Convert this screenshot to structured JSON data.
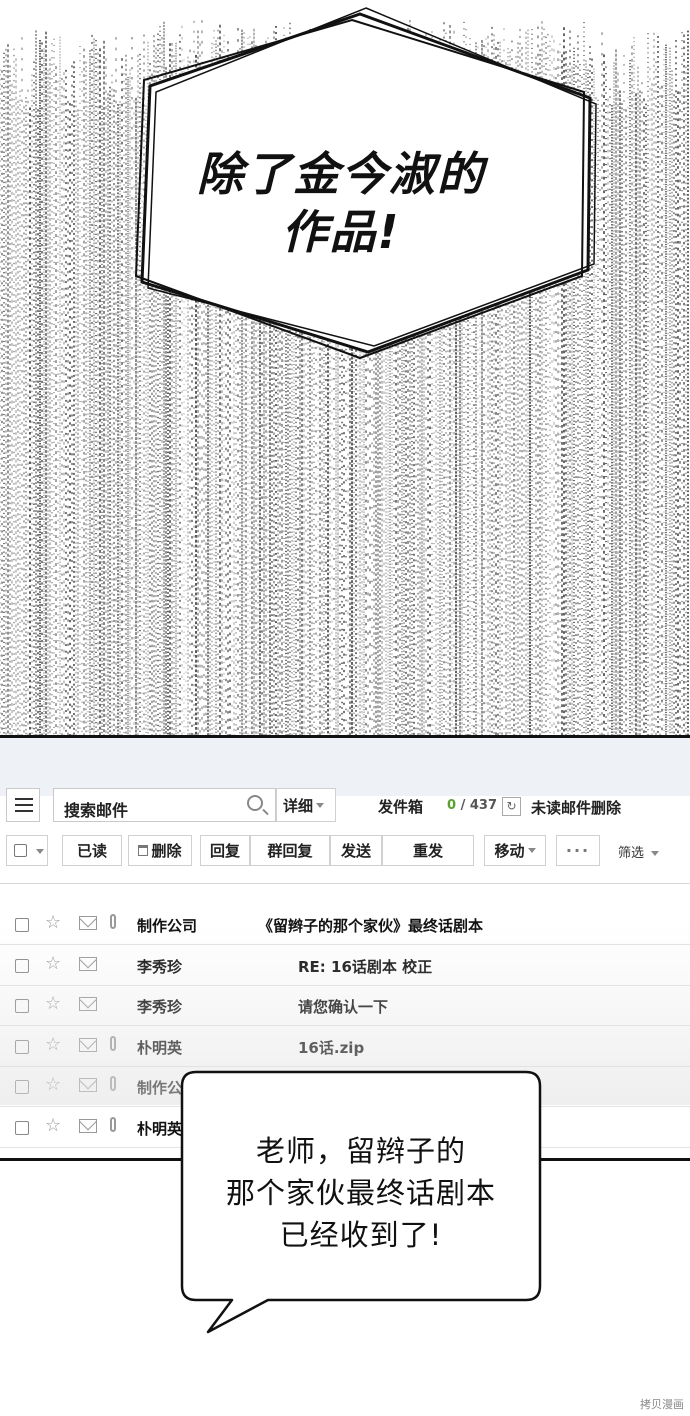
{
  "top_panel": {
    "shout_line_1": "除了金今淑的",
    "shout_line_2": "作品!"
  },
  "mail": {
    "search_placeholder": "搜索邮件",
    "detail_label": "详细",
    "folder_label": "发件箱",
    "unread_count": "0",
    "count_separator": "/",
    "total_count": "437",
    "refresh_icon": "refresh-icon",
    "delete_unread_label": "未读邮件删除",
    "toolbar": {
      "read": "已读",
      "delete": "删除",
      "reply": "回复",
      "reply_all": "群回复",
      "send": "发送",
      "resend": "重发",
      "move": "移动",
      "more": "···",
      "filter": "筛选"
    },
    "rows": [
      {
        "sender": "制作公司",
        "subject": "《留辫子的那个家伙》最终话剧本",
        "attachment": true
      },
      {
        "sender": "李秀珍",
        "subject": "RE: 16话剧本 校正",
        "attachment": false
      },
      {
        "sender": "李秀珍",
        "subject": "请您确认一下",
        "attachment": false
      },
      {
        "sender": "朴明英",
        "subject": "16话.zip",
        "attachment": true
      },
      {
        "sender": "制作公",
        "subject": "",
        "attachment": true
      },
      {
        "sender": "朴明英",
        "subject": "",
        "attachment": true
      }
    ]
  },
  "speech": {
    "line_1": "老师，留辫子的",
    "line_2": "那个家伙最终话剧本",
    "line_3": "已经收到了!"
  },
  "watermark": "拷贝漫画"
}
